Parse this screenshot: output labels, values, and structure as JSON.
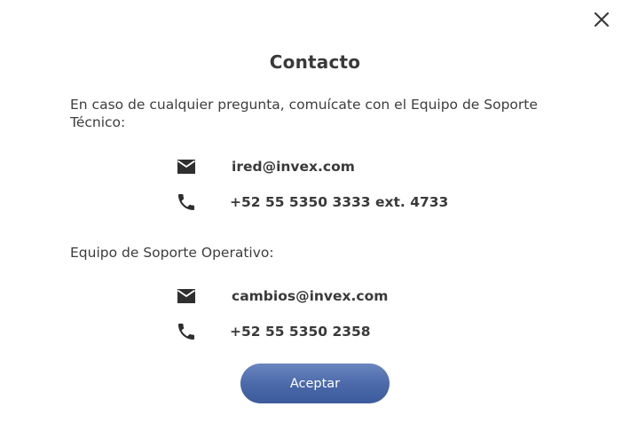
{
  "dialog": {
    "title": "Contacto",
    "close_icon": "close-icon",
    "intro_text": "En caso de cualquier pregunta, comuícate con el Equipo de Soporte Técnico:",
    "technical_support": {
      "email": "ired@invex.com",
      "phone": "+52 55 5350 3333 ext. 4733"
    },
    "operational_label": "Equipo de Soporte Operativo:",
    "operational_support": {
      "email": "cambios@invex.com",
      "phone": "+52 55 5350 2358"
    },
    "accept_label": "Aceptar",
    "icons": {
      "email": "mail-icon",
      "phone": "phone-icon"
    },
    "colors": {
      "accent": "#4a68a8",
      "text": "#3a3a3a",
      "icon": "#333333"
    }
  }
}
